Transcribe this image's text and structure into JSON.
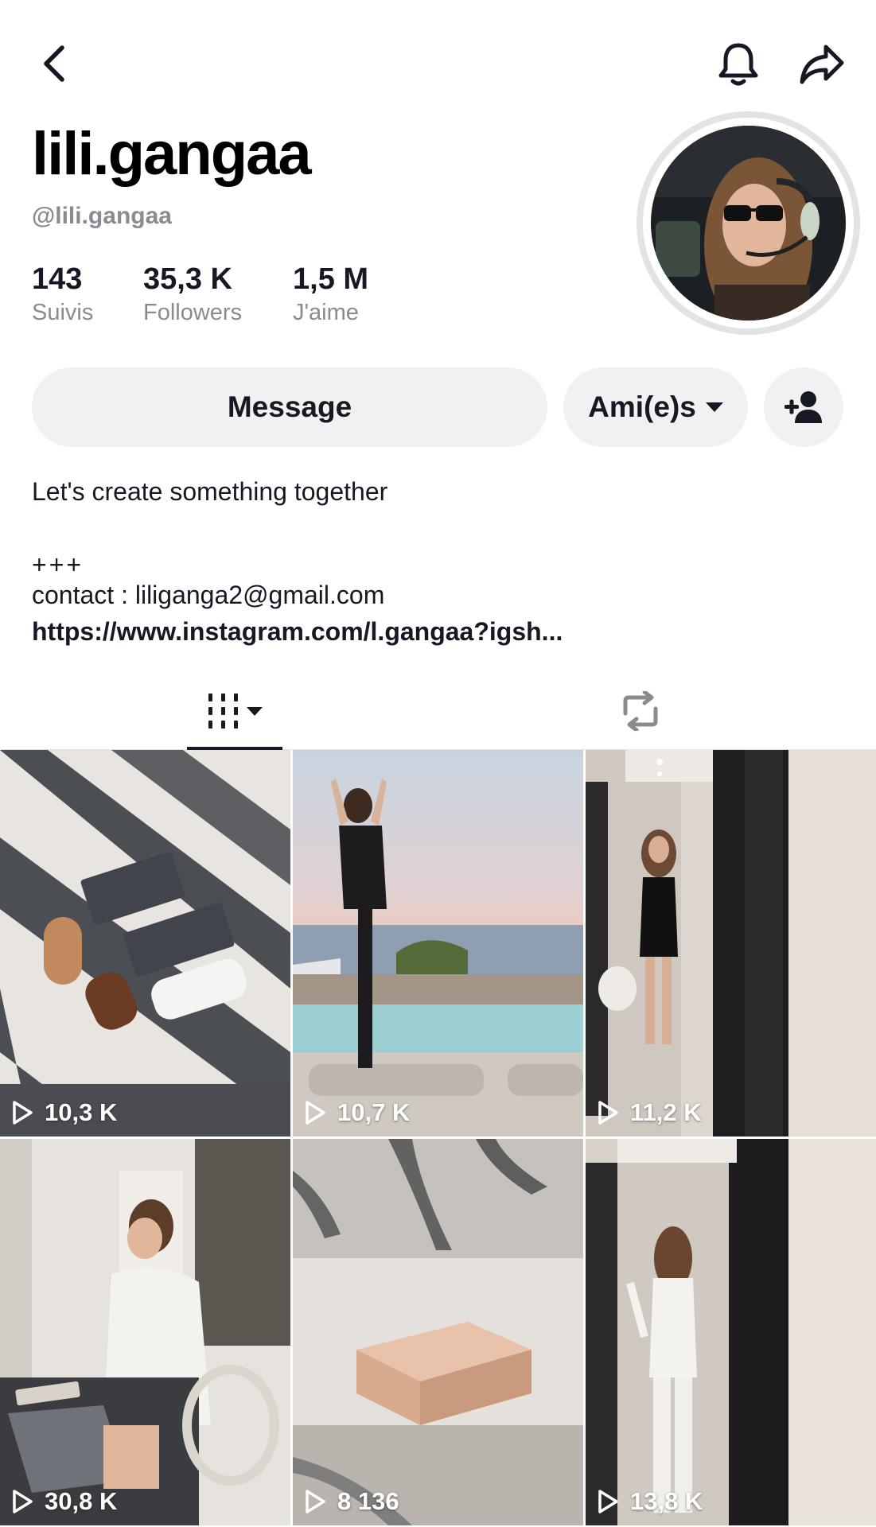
{
  "profile": {
    "display_name": "lili.gangaa",
    "handle": "@lili.gangaa"
  },
  "stats": {
    "following": {
      "value": "143",
      "label": "Suivis"
    },
    "followers": {
      "value": "35,3 K",
      "label": "Followers"
    },
    "likes": {
      "value": "1,5 M",
      "label": "J'aime"
    }
  },
  "actions": {
    "message_label": "Message",
    "friends_label": "Ami(e)s"
  },
  "bio": {
    "line1": "Let's create something together",
    "line2": "+++",
    "line3": "contact : liliganga2@gmail.com",
    "link": "https://www.instagram.com/l.gangaa?igsh..."
  },
  "icons": {
    "back": "chevron-left-icon",
    "notifications": "bell-icon",
    "share": "share-arrow-icon",
    "add_friend": "add-user-icon",
    "videos_tab": "video-grid-icon",
    "reposts_tab": "repost-icon",
    "play": "play-outline-icon"
  },
  "videos": [
    {
      "views": "10,3 K"
    },
    {
      "views": "10,7 K"
    },
    {
      "views": "11,2 K"
    },
    {
      "views": "30,8 K"
    },
    {
      "views": "8 136"
    },
    {
      "views": "13,8 K"
    }
  ],
  "colors": {
    "text_primary": "#161823",
    "text_secondary": "#8a8b91",
    "button_bg": "#f1f1f2"
  }
}
